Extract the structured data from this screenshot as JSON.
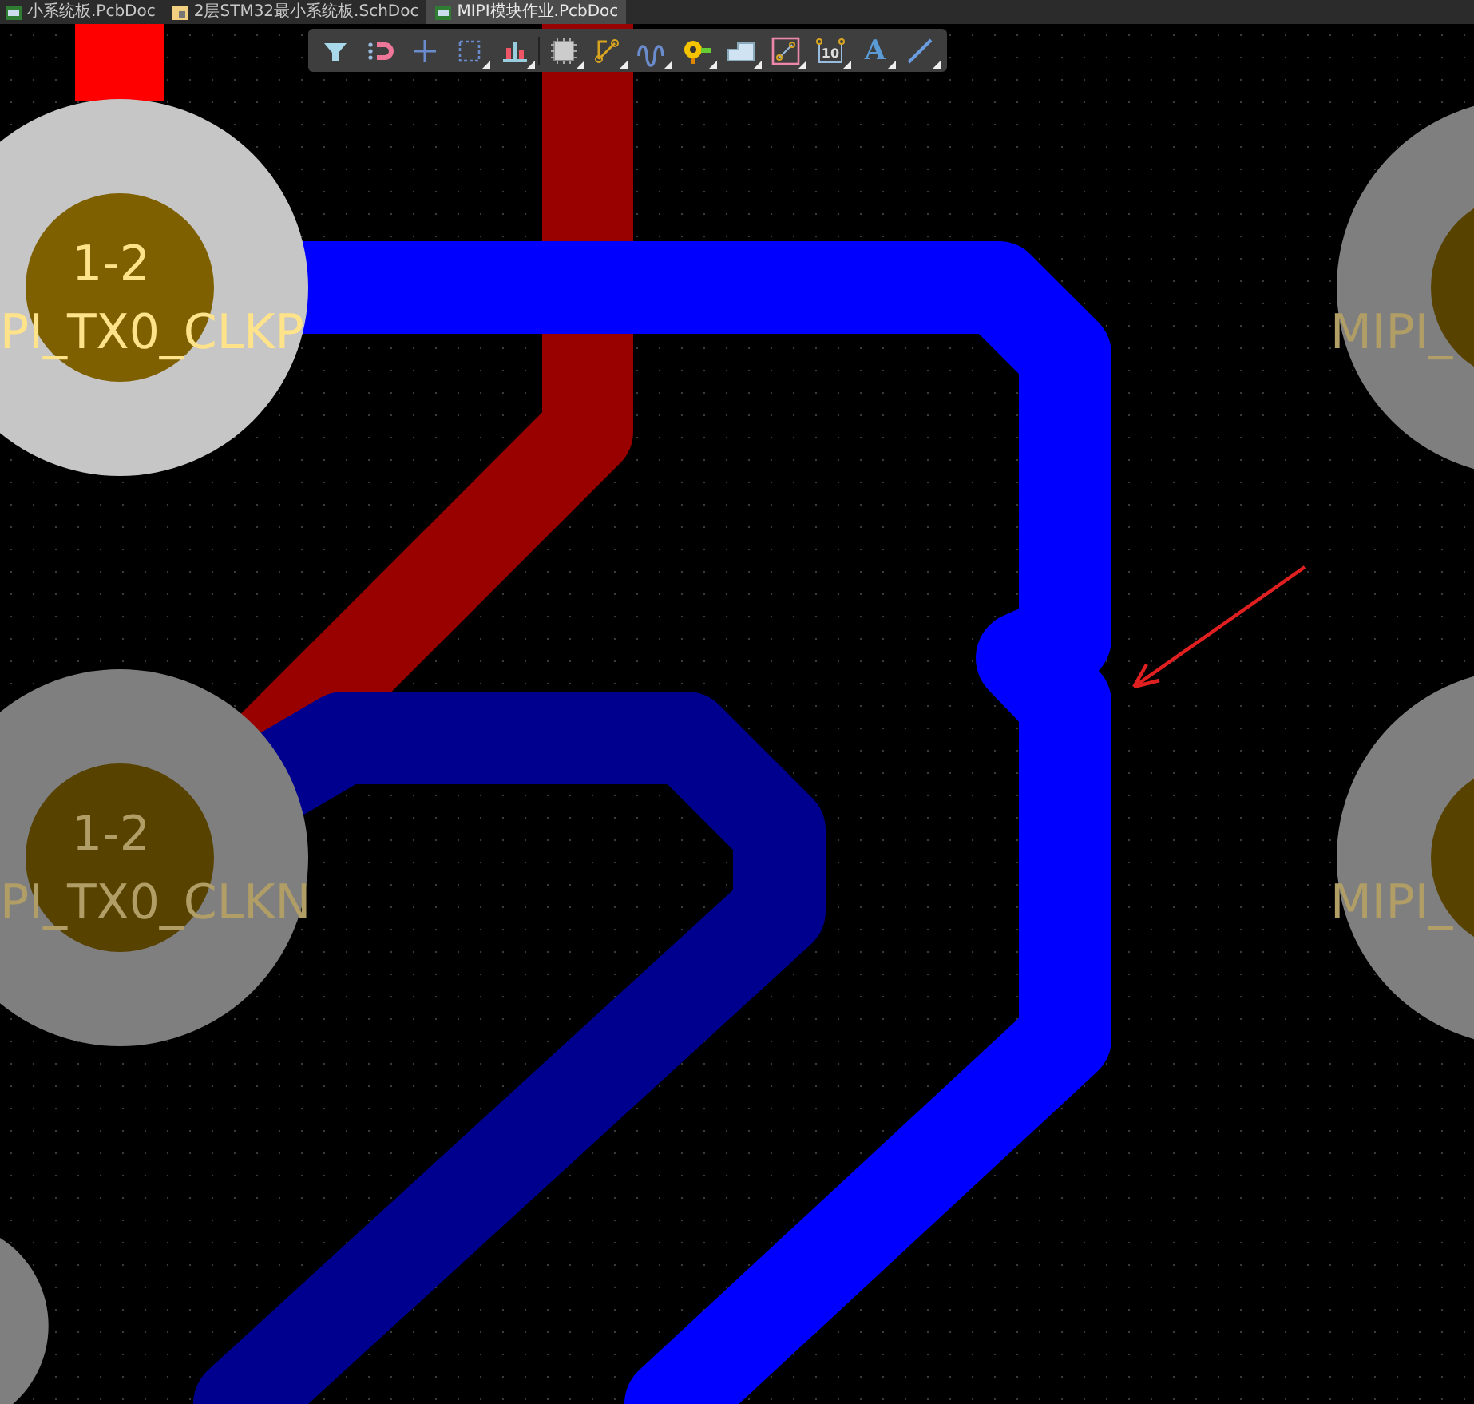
{
  "tabs": [
    {
      "label": "小系统板.PcbDoc",
      "kind": "pcb",
      "selected": false
    },
    {
      "label": "2层STM32最小系统板.SchDoc",
      "kind": "sch",
      "selected": false
    },
    {
      "label": "MIPI模块作业.PcbDoc",
      "kind": "pcb",
      "selected": true
    }
  ],
  "toolbar": {
    "tools": [
      {
        "kind": "filter"
      },
      {
        "kind": "snap"
      },
      {
        "kind": "cross"
      },
      {
        "kind": "select"
      },
      {
        "kind": "align"
      },
      {
        "kind": "component"
      },
      {
        "kind": "route"
      },
      {
        "kind": "tune"
      },
      {
        "kind": "via"
      },
      {
        "kind": "fill"
      },
      {
        "kind": "diffpair"
      },
      {
        "kind": "dimension",
        "label": "10"
      },
      {
        "kind": "string",
        "label": "A"
      },
      {
        "kind": "line"
      }
    ]
  },
  "board": {
    "traces": [
      {
        "color": "#ff0000"
      },
      {
        "color": "#990000"
      },
      {
        "color": "#00008f"
      },
      {
        "color": "#0000ff"
      }
    ],
    "pads": [
      {
        "net": "1-2",
        "name": "PI_TX0_CLKP",
        "highlighted": true
      },
      {
        "net": "1-2",
        "name": "PI_TX0_CLKN",
        "highlighted": false
      },
      {
        "name": "MIPI_",
        "highlighted": false
      },
      {
        "name": "MIPI_",
        "highlighted": false
      },
      {
        "highlighted": false
      }
    ]
  }
}
